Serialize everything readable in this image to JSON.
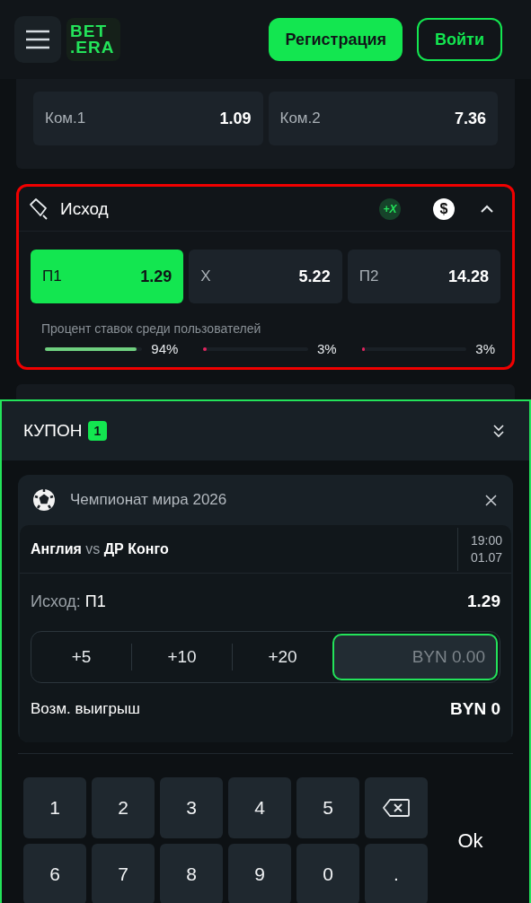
{
  "header": {
    "logo": [
      "BET",
      ".ERA"
    ],
    "buttons": [
      {
        "label": "Регистрация",
        "kind": "primary"
      },
      {
        "label": "Войти",
        "kind": "outline"
      }
    ]
  },
  "top_market": {
    "odds": [
      {
        "label": "Ком.1",
        "value": "1.09"
      },
      {
        "label": "Ком.2",
        "value": "7.36"
      }
    ]
  },
  "outcome_market": {
    "title": "Исход",
    "boost_badge": "+X",
    "coin_badge": "$",
    "expanded": true,
    "odds": [
      {
        "label": "П1",
        "value": "1.29",
        "selected": true
      },
      {
        "label": "Х",
        "value": "5.22",
        "selected": false
      },
      {
        "label": "П2",
        "value": "14.28",
        "selected": false
      }
    ],
    "percent_label": "Процент ставок среди пользователей",
    "shares": [
      {
        "level": 0.94,
        "reading": "94%",
        "color": "#6fcf7f"
      },
      {
        "level": 0.03,
        "reading": "3%",
        "color": "#e0245e"
      },
      {
        "level": 0.03,
        "reading": "3%",
        "color": "#e0245e"
      }
    ]
  },
  "coupon": {
    "title": "КУПОН",
    "count": "1",
    "expanded": true,
    "tournament": "Чемпионат мира 2026",
    "home": "Англия",
    "vs": "vs",
    "away": "ДР Конго",
    "time": "19:00",
    "date": "01.07",
    "bet_market": "Исход:",
    "bet_pick": "П1",
    "odds": "1.29",
    "quick": [
      "+5",
      "+10",
      "+20"
    ],
    "stake": {
      "placeholder": "BYN 0.00"
    },
    "win_label": "Возм. выигрыш",
    "win_value": "BYN 0"
  },
  "keypad": {
    "keys": [
      {
        "kind": "digit",
        "label": "1"
      },
      {
        "kind": "digit",
        "label": "2"
      },
      {
        "kind": "digit",
        "label": "3"
      },
      {
        "kind": "digit",
        "label": "4"
      },
      {
        "kind": "digit",
        "label": "5"
      },
      {
        "kind": "backspace"
      },
      {
        "kind": "digit",
        "label": "6"
      },
      {
        "kind": "digit",
        "label": "7"
      },
      {
        "kind": "digit",
        "label": "8"
      },
      {
        "kind": "digit",
        "label": "9"
      },
      {
        "kind": "digit",
        "label": "0"
      },
      {
        "kind": "digit",
        "label": "."
      }
    ],
    "ok": "Ok"
  }
}
